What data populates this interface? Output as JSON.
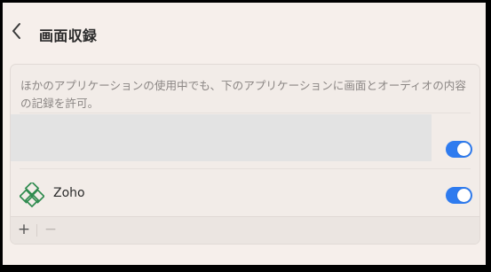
{
  "window": {
    "title": "画面収録"
  },
  "panel": {
    "description": "ほかのアプリケーションの使用中でも、下のアプリケーションに画面とオーディオの内容の記録を許可。",
    "apps": [
      {
        "name": "",
        "enabled": true
      },
      {
        "name": "Zoho",
        "icon": "zoho-logo-icon",
        "enabled": true
      }
    ]
  },
  "toolbar": {
    "add_label": "+",
    "remove_label": "−"
  },
  "colors": {
    "accent": "#2e7bef",
    "background": "#f6efeb",
    "zoho_green": "#2f8b4f"
  }
}
